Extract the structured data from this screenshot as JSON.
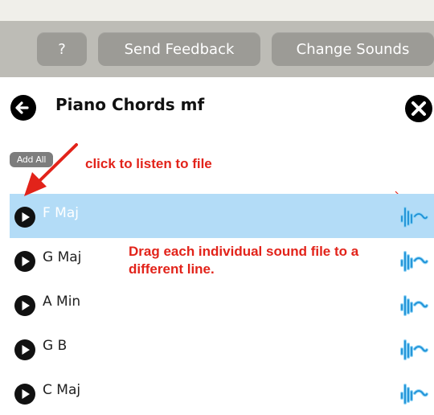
{
  "toolbar": {
    "help_label": "?",
    "feedback_label": "Send Feedback",
    "sounds_label": "Change Sounds"
  },
  "header": {
    "title": "Piano Chords mf"
  },
  "add_all_label": "Add All",
  "annotations": {
    "click_hint": "click to listen to file",
    "drag_hint": "Drag each individual sound file to a different line."
  },
  "sounds": [
    {
      "label": "F Maj",
      "selected": true
    },
    {
      "label": "G Maj",
      "selected": false
    },
    {
      "label": "A Min",
      "selected": false
    },
    {
      "label": "G B",
      "selected": false
    },
    {
      "label": "C Maj",
      "selected": false
    }
  ],
  "colors": {
    "toolbar_bg": "#bdbcb6",
    "button_bg": "#9c9b96",
    "selected_row": "#b3dcf7",
    "annotation_red": "#e2231a",
    "waveform_blue": "#1a8fd6"
  },
  "icons": {
    "back": "back-arrow-icon",
    "close": "close-icon",
    "play": "play-icon",
    "waveform": "waveform-icon"
  }
}
